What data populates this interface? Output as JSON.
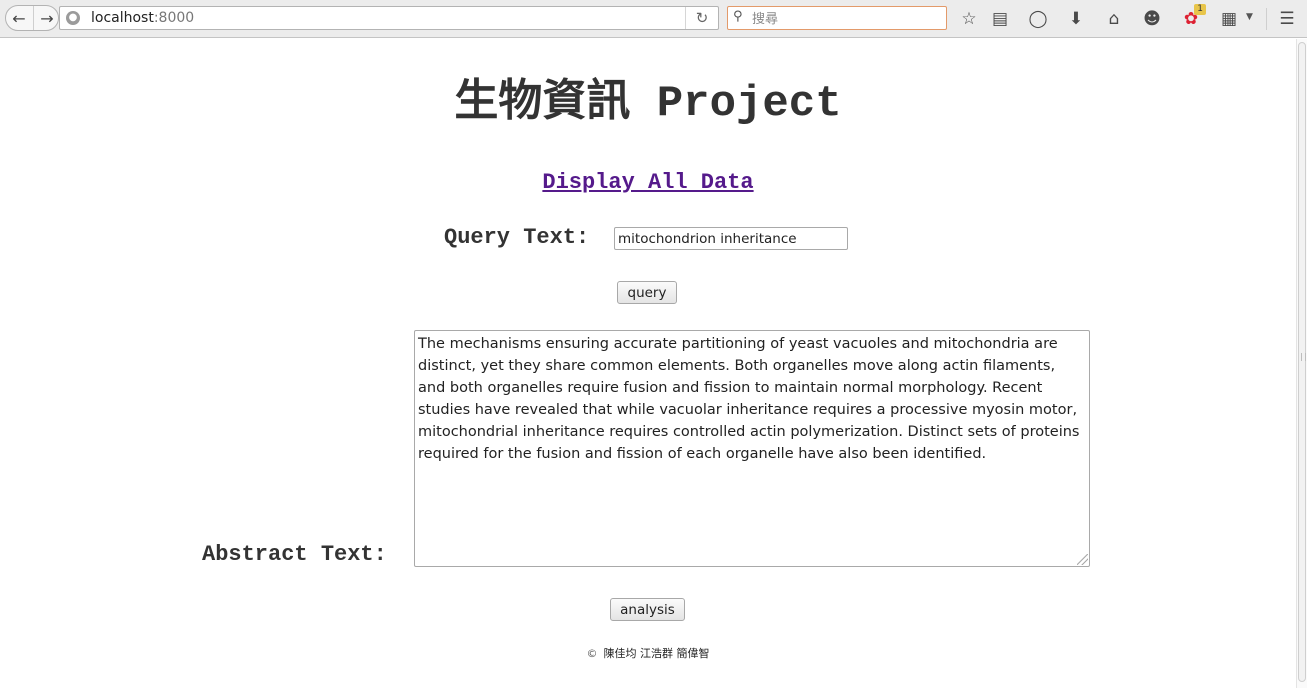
{
  "browser": {
    "url_host": "localhost",
    "url_port": ":8000",
    "search_placeholder": "搜尋",
    "icons": {
      "back": "back-arrow-icon",
      "forward": "forward-arrow-icon",
      "site": "globe-icon",
      "reload": "reload-icon",
      "search": "search-icon",
      "bookmark": "star-icon",
      "reading_list": "reading-list-icon",
      "pocket": "pocket-icon",
      "downloads": "download-icon",
      "home": "home-icon",
      "chat": "chat-icon",
      "addon": "addon-icon",
      "sidebar": "sidebar-icon",
      "menu": "hamburger-menu-icon"
    },
    "addon_badge": "1"
  },
  "page": {
    "title": "生物資訊 Project",
    "display_link": "Display All Data",
    "query_label": "Query Text:",
    "query_value": "mitochondrion inheritance",
    "query_button": "query",
    "abstract_label": "Abstract Text:",
    "abstract_text": "The mechanisms ensuring accurate partitioning of yeast vacuoles and mitochondria are distinct, yet they share common elements. Both organelles move along actin filaments, and both organelles require fusion and fission to maintain normal morphology. Recent studies have revealed that while vacuolar inheritance requires a processive myosin motor, mitochondrial inheritance requires controlled actin polymerization. Distinct sets of proteins required for the fusion and fission of each organelle have also been identified.",
    "analysis_button": "analysis",
    "footer_copyright": "©",
    "footer_authors": "陳佳均  江浩群  簡偉智"
  },
  "colors": {
    "link_visited": "#551a8b",
    "heading": "#333333",
    "search_border": "#e39a6a",
    "badge": "#e8c54a"
  }
}
